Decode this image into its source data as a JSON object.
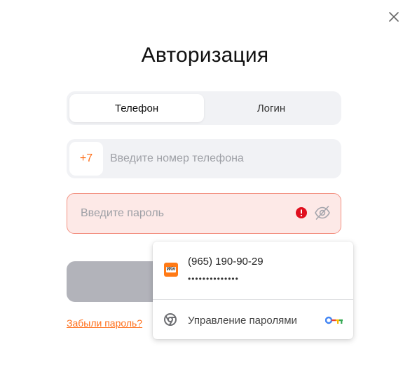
{
  "dialog": {
    "title": "Авторизация",
    "close_icon": "close-icon"
  },
  "tabs": [
    {
      "label": "Телефон",
      "active": true
    },
    {
      "label": "Логин",
      "active": false
    }
  ],
  "phone": {
    "prefix": "+7",
    "value": "",
    "placeholder": "Введите номер телефона"
  },
  "password": {
    "value": "",
    "placeholder": "Введите пароль",
    "error_icon": "error-icon",
    "visibility_icon": "eye-slash-icon",
    "border_color": "#f39283",
    "background_color": "#fde9e7"
  },
  "submit": {
    "label": "",
    "color": "#b2b3ba"
  },
  "forgot_password": "Забыли пароль?",
  "autofill_popup": {
    "credential": {
      "username": "(965) 190-90-29",
      "password_mask": "••••••••••••••",
      "site_icon": "site-favicon",
      "site_icon_text": "Win"
    },
    "manage": {
      "label": "Управление паролями",
      "icon": "chrome-icon",
      "key_icon": "key-icon"
    }
  },
  "colors": {
    "accent": "#ff6f1a",
    "tab_background": "#f1f2f5",
    "error": "#e0101f"
  }
}
